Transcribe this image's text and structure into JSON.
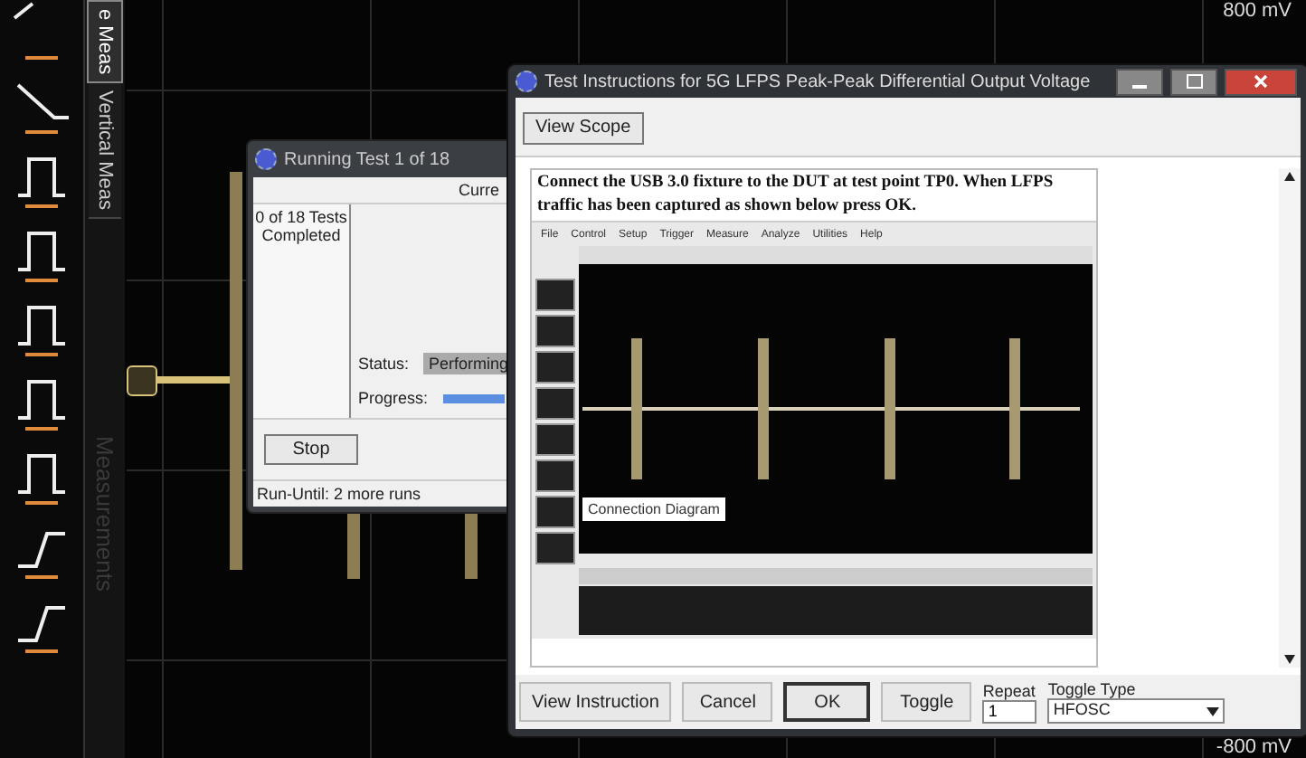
{
  "scope": {
    "top_reading": "800 mV",
    "bottom_reading": "-800 mV"
  },
  "side_tabs": [
    {
      "label": "e Meas",
      "selected": true
    },
    {
      "label": "Vertical Meas",
      "selected": false
    }
  ],
  "side_panel_title": "Measurements",
  "run_window": {
    "title": "Running Test 1 of 18",
    "header": "Curre",
    "tests_completed": "0 of 18 Tests Completed",
    "status_label": "Status:",
    "status_value": "Performing",
    "progress_label": "Progress:",
    "progress": {
      "level": 1
    },
    "stop_button": "Stop",
    "footer": "Run-Until: 2 more runs"
  },
  "instr_window": {
    "title": "Test Instructions for 5G LFPS Peak-Peak Differential Output Voltage",
    "view_scope": "View Scope",
    "instruction": "Connect the USB 3.0 fixture to the DUT at test point TP0. When LFPS traffic has been captured as shown below press OK.",
    "image": {
      "menu": [
        "File",
        "Control",
        "Setup",
        "Trigger",
        "Measure",
        "Analyze",
        "Utilities",
        "Help"
      ],
      "caption": "Connection Diagram"
    },
    "buttons": [
      {
        "label": "View Instruction",
        "focused": false
      },
      {
        "label": "Cancel",
        "focused": false
      },
      {
        "label": "OK",
        "focused": true
      },
      {
        "label": "Toggle",
        "focused": false
      }
    ],
    "repeat": {
      "label": "Repeat",
      "value": "1"
    },
    "toggle_type": {
      "label": "Toggle Type",
      "value": "HFOSC"
    }
  }
}
